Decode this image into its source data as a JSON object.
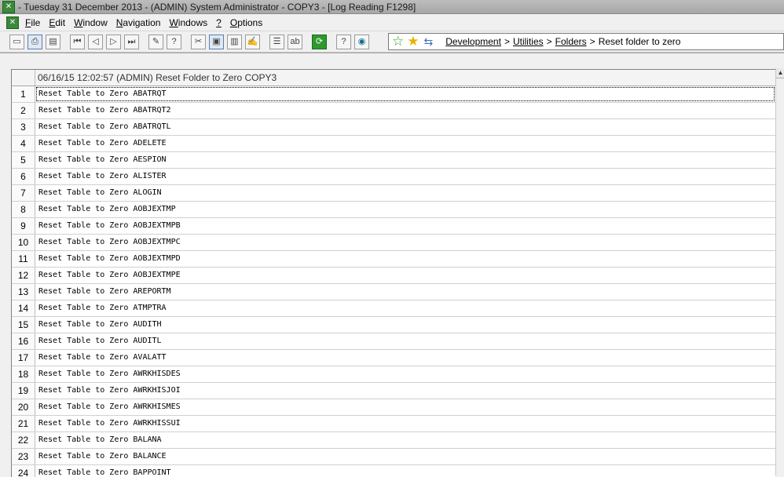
{
  "window": {
    "title": "- Tuesday 31 December 2013 - (ADMIN) System Administrator - COPY3 - [Log Reading F1298]"
  },
  "menu": {
    "items": [
      "File",
      "Edit",
      "Window",
      "Navigation",
      "Windows",
      "?",
      "Options"
    ]
  },
  "toolbar": {
    "icons": [
      "new-doc-icon",
      "print-icon",
      "print-preview-icon",
      "first-record-icon",
      "previous-record-icon",
      "next-record-icon",
      "last-record-icon",
      "attach-icon",
      "help-icon",
      "tool-a-icon",
      "tool-b-icon",
      "tool-c-icon",
      "tool-d-icon",
      "list-icon",
      "text-field-icon",
      "refresh-icon",
      "question-icon",
      "monitor-icon"
    ],
    "field_glyph": "ab|",
    "text_glyph": "ab"
  },
  "breadcrumb": {
    "items": [
      "Development",
      "Utilities",
      "Folders"
    ],
    "current": "Reset folder to zero"
  },
  "grid": {
    "header": "06/16/15 12:02:57 (ADMIN) Reset Folder to Zero COPY3",
    "rows": [
      {
        "n": "1",
        "text": "Reset Table to Zero ABATRQT"
      },
      {
        "n": "2",
        "text": "Reset Table to Zero ABATRQT2"
      },
      {
        "n": "3",
        "text": "Reset Table to Zero ABATRQTL"
      },
      {
        "n": "4",
        "text": "Reset Table to Zero ADELETE"
      },
      {
        "n": "5",
        "text": "Reset Table to Zero AESPION"
      },
      {
        "n": "6",
        "text": "Reset Table to Zero ALISTER"
      },
      {
        "n": "7",
        "text": "Reset Table to Zero ALOGIN"
      },
      {
        "n": "8",
        "text": "Reset Table to Zero AOBJEXTMP"
      },
      {
        "n": "9",
        "text": "Reset Table to Zero AOBJEXTMPB"
      },
      {
        "n": "10",
        "text": "Reset Table to Zero AOBJEXTMPC"
      },
      {
        "n": "11",
        "text": "Reset Table to Zero AOBJEXTMPD"
      },
      {
        "n": "12",
        "text": "Reset Table to Zero AOBJEXTMPE"
      },
      {
        "n": "13",
        "text": "Reset Table to Zero AREPORTM"
      },
      {
        "n": "14",
        "text": "Reset Table to Zero ATMPTRA"
      },
      {
        "n": "15",
        "text": "Reset Table to Zero AUDITH"
      },
      {
        "n": "16",
        "text": "Reset Table to Zero AUDITL"
      },
      {
        "n": "17",
        "text": "Reset Table to Zero AVALATT"
      },
      {
        "n": "18",
        "text": "Reset Table to Zero AWRKHISDES"
      },
      {
        "n": "19",
        "text": "Reset Table to Zero AWRKHISJOI"
      },
      {
        "n": "20",
        "text": "Reset Table to Zero AWRKHISMES"
      },
      {
        "n": "21",
        "text": "Reset Table to Zero AWRKHISSUI"
      },
      {
        "n": "22",
        "text": "Reset Table to Zero BALANA"
      },
      {
        "n": "23",
        "text": "Reset Table to Zero BALANCE"
      },
      {
        "n": "24",
        "text": "Reset Table to Zero BAPPOINT"
      }
    ]
  }
}
